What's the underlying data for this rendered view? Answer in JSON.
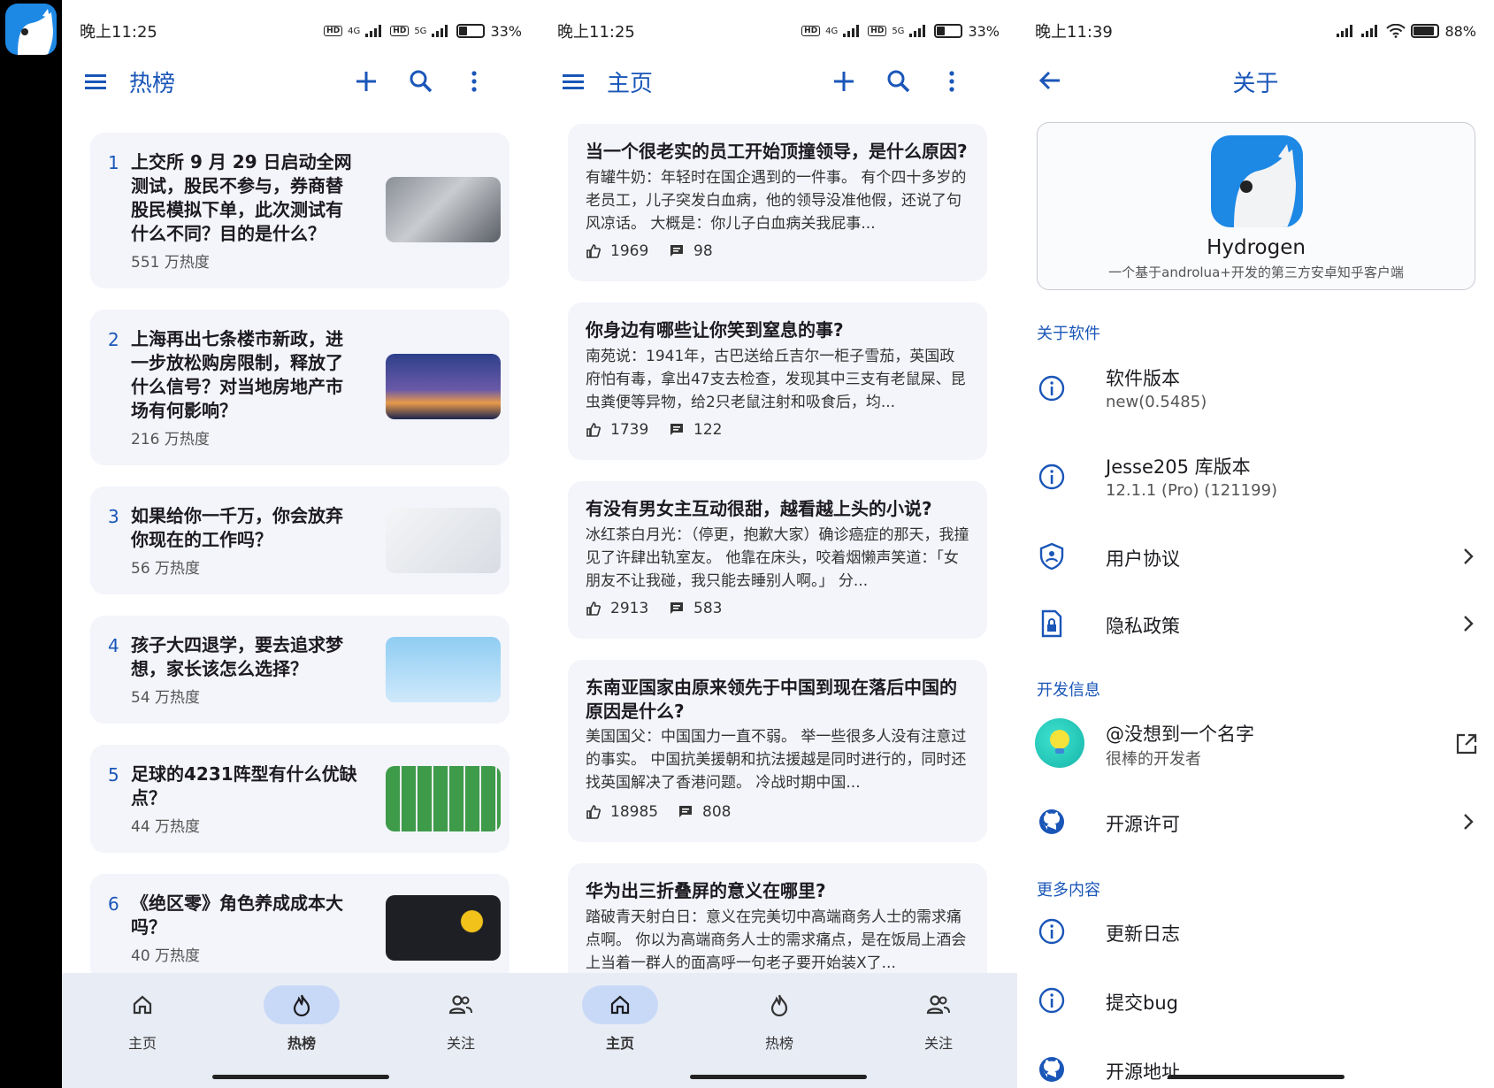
{
  "colors": {
    "accent": "#1a56b8",
    "card_bg": "#f3f5fa",
    "nav_bg": "#e8ecf5",
    "nav_active": "#c8d9f7"
  },
  "hot_screen": {
    "status": {
      "time": "晚上11:25",
      "battery": "33%",
      "net1": "4G",
      "net2": "5G",
      "battery_level": 0.33
    },
    "title": "热榜",
    "items": [
      {
        "rank": "1",
        "title": "上交所 9 月 29 日启动全网测试，股民不参与，券商替股民模拟下单，此次测试有什么不同？目的是什么？",
        "heat": "551 万热度"
      },
      {
        "rank": "2",
        "title": "上海再出七条楼市新政，进一步放松购房限制，释放了什么信号？对当地房地产市场有何影响？",
        "heat": "216 万热度"
      },
      {
        "rank": "3",
        "title": "如果给你一千万，你会放弃你现在的工作吗？",
        "heat": "56 万热度"
      },
      {
        "rank": "4",
        "title": "孩子大四退学，要去追求梦想，家长该怎么选择？",
        "heat": "54 万热度"
      },
      {
        "rank": "5",
        "title": "足球的4231阵型有什么优缺点？",
        "heat": "44 万热度"
      },
      {
        "rank": "6",
        "title": "《绝区零》角色养成成本大吗？",
        "heat": "40 万热度"
      }
    ]
  },
  "home_screen": {
    "status": {
      "time": "晚上11:25",
      "battery": "33%",
      "net1": "4G",
      "net2": "5G",
      "battery_level": 0.33
    },
    "title": "主页",
    "items": [
      {
        "title": "当一个很老实的员工开始顶撞领导，是什么原因?",
        "excerpt": "有罐牛奶：年轻时在国企遇到的一件事。 有个四十多岁的老员工，儿子突发白血病，他的领导没准他假，还说了句风凉话。 大概是：你儿子白血病关我屁事...",
        "likes": "1969",
        "comments": "98"
      },
      {
        "title": "你身边有哪些让你笑到窒息的事?",
        "excerpt": "南苑说：1941年，古巴送给丘吉尔一柜子雪茄，英国政府怕有毒，拿出47支去检查，发现其中三支有老鼠屎、昆虫粪便等异物，给2只老鼠注射和吸食后，均...",
        "likes": "1739",
        "comments": "122"
      },
      {
        "title": "有没有男女主互动很甜，越看越上头的小说?",
        "excerpt": "冰红茶白月光：（停更，抱歉大家）确诊癌症的那天，我撞见了许肆出轨室友。 他靠在床头，咬着烟懒声笑道：「女朋友不让我碰，我只能去睡别人啊。」 分...",
        "likes": "2913",
        "comments": "583"
      },
      {
        "title": "东南亚国家由原来领先于中国到现在落后中国的原因是什么?",
        "excerpt": "美国国父：中国国力一直不弱。 举一些很多人没有注意过的事实。 中国抗美援朝和抗法援越是同时进行的，同时还找英国解决了香港问题。 冷战时期中国...",
        "likes": "18985",
        "comments": "808"
      },
      {
        "title": "华为出三折叠屏的意义在哪里?",
        "excerpt": "踏破青天射白日：意义在完美切中高端商务人士的需求痛点啊。 你以为高端商务人士的需求痛点，是在饭局上酒会上当着一群人的面高呼一句老子要开始装X了...",
        "likes": "",
        "comments": ""
      }
    ]
  },
  "nav": {
    "home": "主页",
    "hot": "热榜",
    "follow": "关注"
  },
  "about_screen": {
    "status": {
      "time": "晚上11:39",
      "battery": "88%",
      "battery_level": 0.88
    },
    "title": "关于",
    "app_name": "Hydrogen",
    "app_desc": "一个基于androlua+开发的第三方安卓知乎客户端",
    "sec_software": "关于软件",
    "version_label": "软件版本",
    "version_value": "new(0.5485)",
    "lib_label": "Jesse205 库版本",
    "lib_value": "12.1.1 (Pro) (121199)",
    "agreement": "用户协议",
    "privacy": "隐私政策",
    "sec_dev": "开发信息",
    "dev_name": "@没想到一个名字",
    "dev_sub": "很棒的开发者",
    "license": "开源许可",
    "sec_more": "更多内容",
    "changelog": "更新日志",
    "bug": "提交bug",
    "source": "开源地址"
  }
}
